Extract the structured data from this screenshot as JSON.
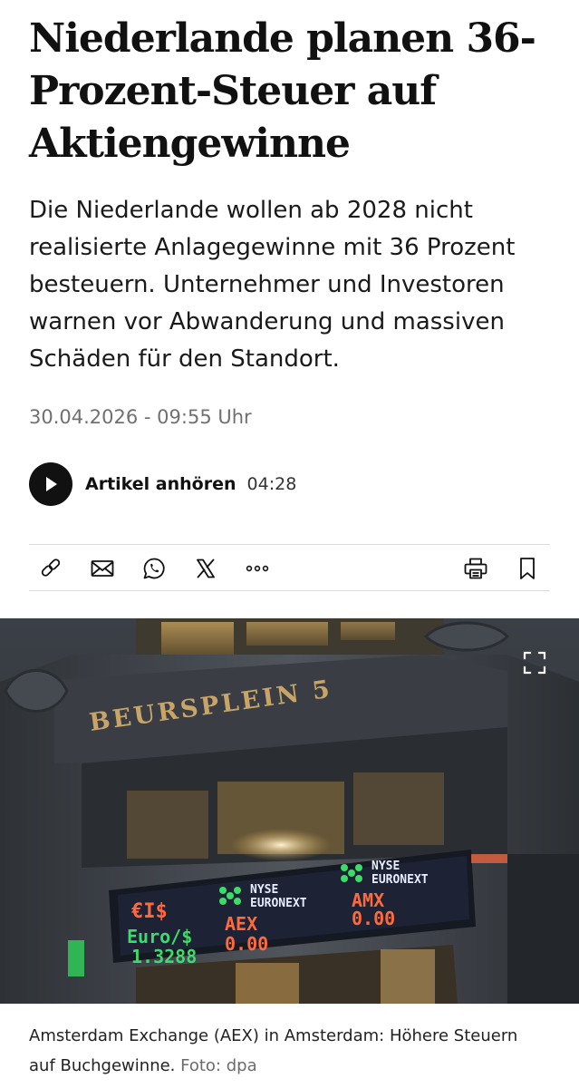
{
  "article": {
    "headline_lines": [
      "Niederlande planen 36-",
      "Prozent-Steuer auf",
      "Aktiengewinne"
    ],
    "lead_lines": [
      "Die Niederlande wollen ab 2028 nicht",
      "realisierte Anlagegewinne mit 36 Prozent",
      "besteuern. Unternehmer und Investoren",
      "warnen vor Abwanderung und massiven",
      "Schäden für den Standort."
    ],
    "dateline": "30.04.2026 - 09:55 Uhr"
  },
  "audio": {
    "label": "Artikel anhören",
    "duration": "04:28"
  },
  "share": {
    "icons": [
      "link-icon",
      "mail-icon",
      "whatsapp-icon",
      "x-icon",
      "more-icon",
      "print-icon",
      "bookmark-icon"
    ]
  },
  "photo": {
    "sign_text": "BEURSPLEIN 5",
    "ticker": {
      "brand_line1": "NYSE",
      "brand_line2": "EURONEXT",
      "euro_symbol": "€I$",
      "euro_label": "Euro/$",
      "euro_value": "1.3288",
      "aex_label": "AEX",
      "aex_value": "0.00",
      "amx_label": "AMX",
      "amx_value": "0.00"
    },
    "caption_line1": "Amsterdam Exchange (AEX) in Amsterdam: Höhere Steuern",
    "caption_line2": "auf Buchgewinne.",
    "credit": "Foto: dpa"
  },
  "colors": {
    "text": "#111111",
    "muted": "#707070",
    "divider": "#dcdcdc",
    "ticker_green": "#3ddc6a",
    "ticker_orange": "#ff6a3d",
    "ticker_white": "#e8ecff"
  }
}
